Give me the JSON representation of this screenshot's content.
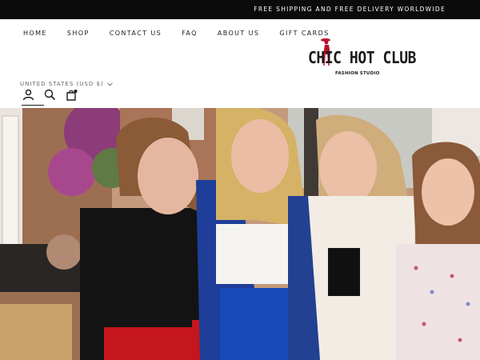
{
  "announcement": "FREE SHIPPING AND FREE DELIVERY WORLDWIDE",
  "nav": [
    "HOME",
    "SHOP",
    "CONTACT US",
    "FAQ",
    "ABOUT US",
    "GIFT CARDS"
  ],
  "logo": {
    "brand": "CHIC HOT CLUB",
    "tagline": "FASHION STUDIO",
    "accent": "#b3132b"
  },
  "currency": "UNITED STATES (USD $)",
  "icons": [
    "account-icon",
    "search-icon",
    "cart-icon"
  ],
  "hero_alt": "Four women laughing together outdoors"
}
